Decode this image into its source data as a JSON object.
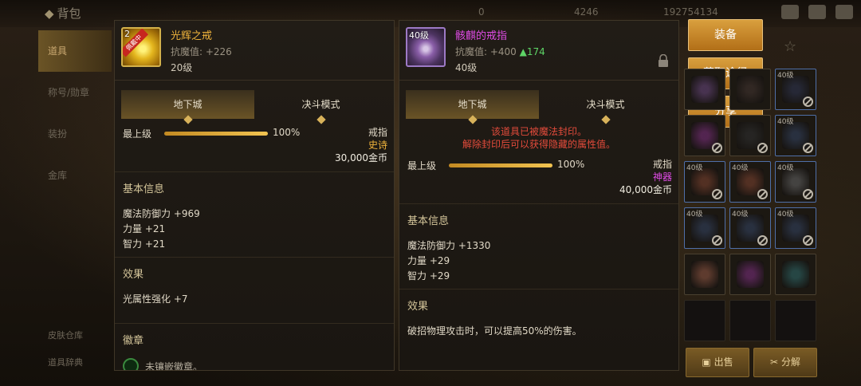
{
  "background": {
    "title": "背包",
    "currencies": [
      "0",
      "4246",
      "192754134"
    ],
    "nav": [
      "道具",
      "称号/勋章",
      "装扮",
      "金库"
    ],
    "nav_bottom": [
      "皮肤仓库",
      "道具辞典"
    ]
  },
  "left_item": {
    "level_tag": "2",
    "ribbon": "佩戴中",
    "name": "光辉之戒",
    "name_color": "#f0b43c",
    "stat": "抗魔值: +226",
    "level": "20级",
    "tabs": [
      "地下城",
      "决斗模式"
    ],
    "grade_label": "最上级",
    "grade_pct": "100%",
    "grade_fill": 1.0,
    "type": "戒指",
    "rarity": "史诗",
    "rarity_color": "#f0b43c",
    "price": "30,000金币",
    "basic_title": "基本信息",
    "basic_stats": [
      "魔法防御力 +969",
      "力量 +21",
      "智力 +21"
    ],
    "effect_title": "效果",
    "effects": [
      "光属性强化 +7"
    ],
    "badge_title": "徽章",
    "badge_text": "未镶嵌徽章。"
  },
  "right_item": {
    "level_tag": "40级",
    "name": "骸麒的戒指",
    "name_color": "#e04ce6",
    "stat": "抗魔值: +400",
    "stat_up": "▲174",
    "level": "40级",
    "tabs": [
      "地下城",
      "决斗模式"
    ],
    "warning": [
      "该道具已被魔法封印。",
      "解除封印后可以获得隐藏的属性值。"
    ],
    "grade_label": "最上级",
    "grade_pct": "100%",
    "grade_fill": 1.0,
    "type": "戒指",
    "rarity": "神器",
    "rarity_color": "#e04ce6",
    "price": "40,000金币",
    "basic_title": "基本信息",
    "basic_stats": [
      "魔法防御力 +1330",
      "力量 +29",
      "智力 +29"
    ],
    "effect_title": "效果",
    "effects": [
      "破招物理攻击时，可以提高50%的伤害。"
    ]
  },
  "actions": {
    "equip": "装备",
    "obtain": "获取途径",
    "share": "分享",
    "sell": "出售",
    "disassemble": "分解"
  },
  "inventory": [
    {
      "lv": "",
      "ban": false,
      "color": "#5a3e6a",
      "blue": false
    },
    {
      "lv": "",
      "ban": false,
      "color": "#3a2e2a",
      "blue": false
    },
    {
      "lv": "40级",
      "ban": true,
      "color": "#2a2f45",
      "blue": true
    },
    {
      "lv": "",
      "ban": true,
      "color": "#6a2a6a",
      "blue": false
    },
    {
      "lv": "",
      "ban": true,
      "color": "#2a2a2a",
      "blue": false
    },
    {
      "lv": "40级",
      "ban": true,
      "color": "#2e3a52",
      "blue": true
    },
    {
      "lv": "40级",
      "ban": true,
      "color": "#6a3a2a",
      "blue": true
    },
    {
      "lv": "40级",
      "ban": true,
      "color": "#6a3a2a",
      "blue": true
    },
    {
      "lv": "40级",
      "ban": true,
      "color": "#555555",
      "blue": true
    },
    {
      "lv": "40级",
      "ban": true,
      "color": "#2e3a52",
      "blue": true
    },
    {
      "lv": "40级",
      "ban": true,
      "color": "#2e3a52",
      "blue": true
    },
    {
      "lv": "40级",
      "ban": true,
      "color": "#2e3a52",
      "blue": true
    },
    {
      "lv": "",
      "ban": false,
      "color": "#7a4a3a",
      "blue": false
    },
    {
      "lv": "",
      "ban": false,
      "color": "#6a2a6a",
      "blue": false
    },
    {
      "lv": "",
      "ban": false,
      "color": "#2a5a5a",
      "blue": false
    },
    {
      "lv": "",
      "ban": false,
      "color": "",
      "blue": false
    },
    {
      "lv": "",
      "ban": false,
      "color": "",
      "blue": false
    },
    {
      "lv": "",
      "ban": false,
      "color": "",
      "blue": false
    }
  ]
}
